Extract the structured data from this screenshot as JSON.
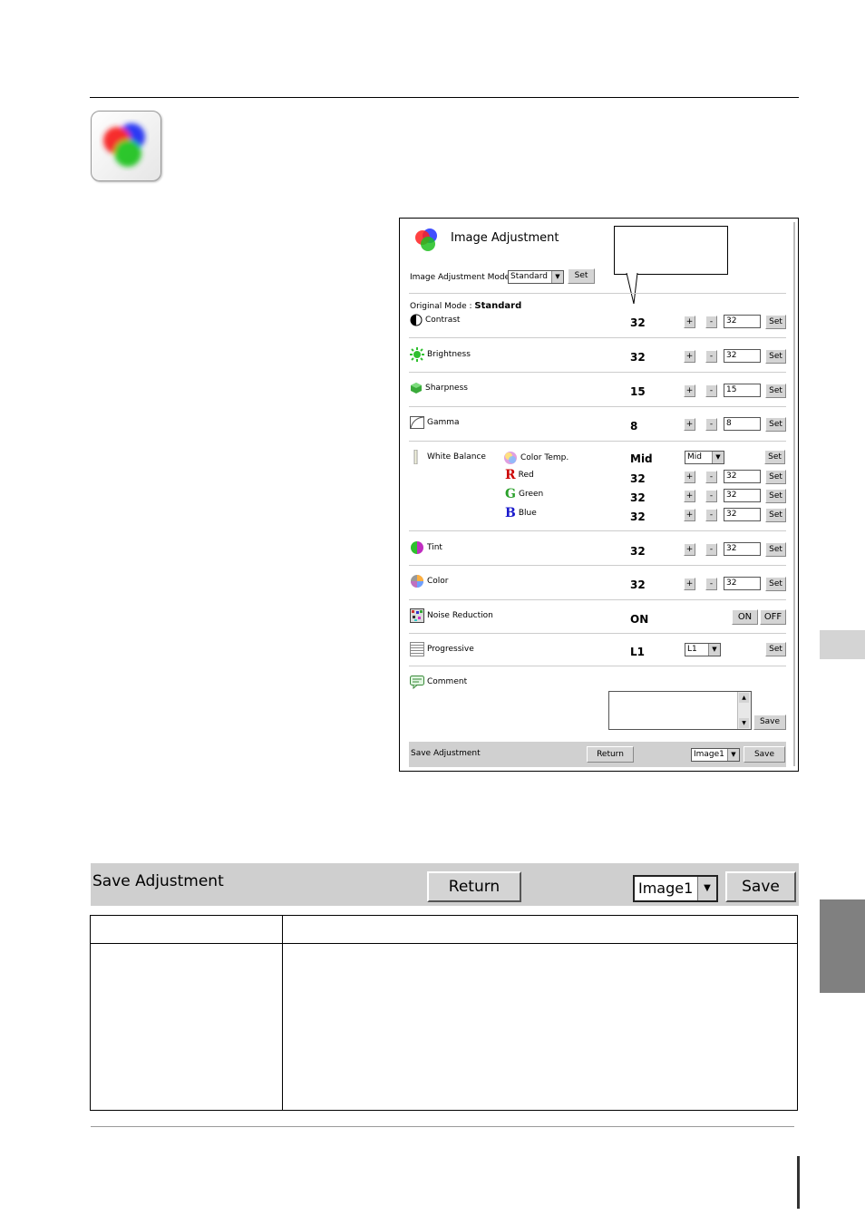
{
  "window": {
    "title": "Image Adjustment",
    "mode_label": "Image Adjustment Mode",
    "mode_value": "Standard",
    "set_label": "Set",
    "original_mode_label": "Original Mode :",
    "original_mode_value": "Standard",
    "plus": "+",
    "minus": "-",
    "rows": {
      "contrast": {
        "label": "Contrast",
        "value": "32",
        "input": "32"
      },
      "brightness": {
        "label": "Brightness",
        "value": "32",
        "input": "32"
      },
      "sharpness": {
        "label": "Sharpness",
        "value": "15",
        "input": "15"
      },
      "gamma": {
        "label": "Gamma",
        "value": "8",
        "input": "8"
      },
      "white_balance": {
        "label": "White Balance"
      },
      "color_temp": {
        "label": "Color Temp.",
        "value": "Mid",
        "select": "Mid"
      },
      "red": {
        "letter": "R",
        "label": "Red",
        "value": "32",
        "input": "32"
      },
      "green": {
        "letter": "G",
        "label": "Green",
        "value": "32",
        "input": "32"
      },
      "blue": {
        "letter": "B",
        "label": "Blue",
        "value": "32",
        "input": "32"
      },
      "tint": {
        "label": "Tint",
        "value": "32",
        "input": "32"
      },
      "color": {
        "label": "Color",
        "value": "32",
        "input": "32"
      },
      "noise_reduction": {
        "label": "Noise Reduction",
        "value": "ON",
        "on_label": "ON",
        "off_label": "OFF"
      },
      "progressive": {
        "label": "Progressive",
        "value": "L1",
        "select": "L1"
      },
      "comment": {
        "label": "Comment",
        "save_label": "Save"
      }
    },
    "save_bar": {
      "label": "Save Adjustment",
      "return_label": "Return",
      "select": "Image1",
      "save_label": "Save"
    }
  },
  "big_bar": {
    "label": "Save Adjustment",
    "return_label": "Return",
    "select": "Image1",
    "save_label": "Save"
  },
  "colors": {
    "red": "#cc0000",
    "green": "#2aa02a",
    "blue": "#1a1acc",
    "bar_gray": "#cfcfcf"
  }
}
